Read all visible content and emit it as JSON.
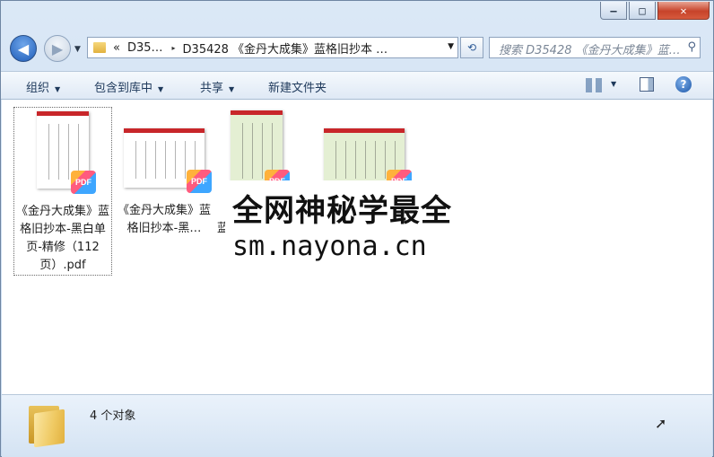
{
  "window": {
    "controls": {
      "minimize": "–",
      "maximize": "□",
      "close": "✕"
    }
  },
  "nav": {
    "back_icon": "◀",
    "forward_icon": "▶",
    "address_segments": [
      "«",
      "D35…",
      "▸",
      "D35428 《金丹大成集》蓝格旧抄本 …"
    ],
    "search_placeholder": "搜索 D35428 《金丹大成集》蓝…"
  },
  "toolbar": {
    "organize": "组织",
    "include_library": "包含到库中",
    "share": "共享",
    "new_folder": "新建文件夹"
  },
  "files": [
    {
      "name": "《金丹大成集》蓝格旧抄本-黑白单页-精修（112页）.pdf",
      "badge": "PDF",
      "selected": true
    },
    {
      "name": "《金丹大成集》蓝格旧抄本-黑…",
      "badge": "PDF",
      "selected": false
    },
    {
      "name": "蓝",
      "badge": "PDF",
      "selected": false
    },
    {
      "name": "",
      "badge": "PDF",
      "selected": false
    }
  ],
  "overlay": {
    "line1": "全网神秘学最全",
    "line2": "sm.nayona.cn"
  },
  "status": {
    "count_text": "4 个对象"
  }
}
